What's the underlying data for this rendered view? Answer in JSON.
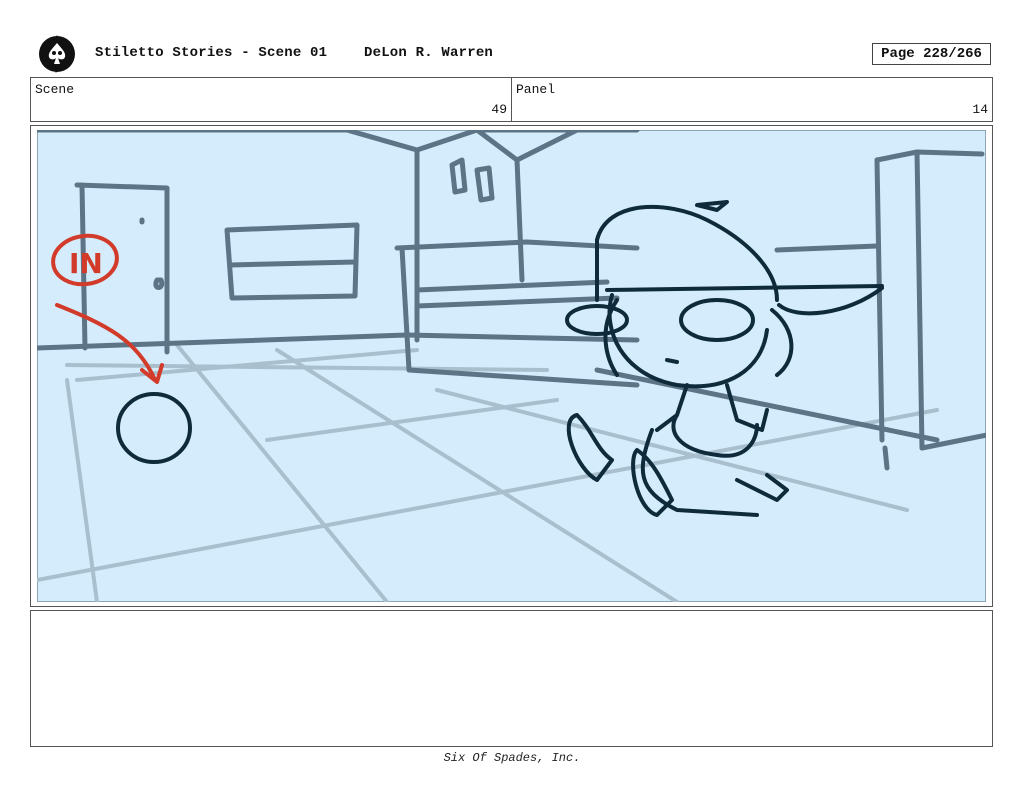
{
  "header": {
    "title": "Stiletto Stories - Scene 01",
    "author": "DeLon R. Warren",
    "page": "Page 228/266"
  },
  "info": {
    "scene_label": "Scene",
    "scene_value": "49",
    "panel_label": "Panel",
    "panel_value": "14"
  },
  "drawing": {
    "annotation": "IN",
    "annotation_color": "#d23b2a",
    "background_color": "#d4ecfb",
    "line_color": "#5d7486",
    "ink_color": "#0f2a3a"
  },
  "footer": {
    "company": "Six Of Spades, Inc."
  }
}
